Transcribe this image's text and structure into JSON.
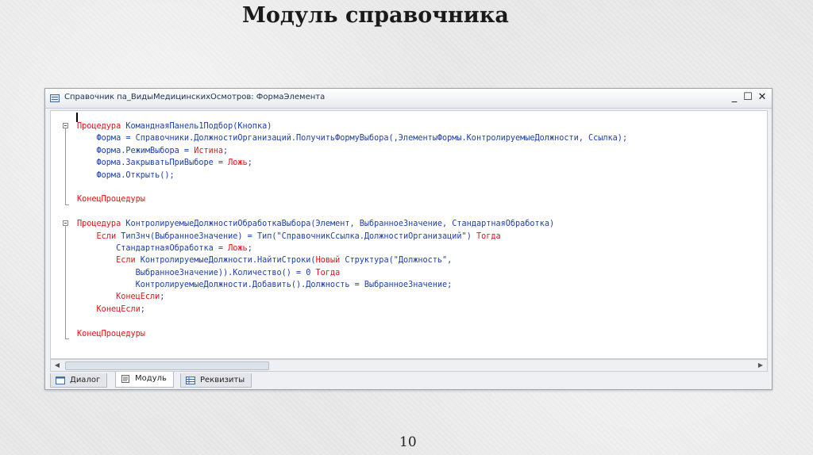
{
  "slide": {
    "title": "Модуль справочника",
    "page_number": "10"
  },
  "window": {
    "title": "Справочник па_ВидыМедицинскихОсмотров: ФормаЭлемента",
    "minimize_symbol": "_",
    "maximize_symbol": "☐",
    "close_symbol": "✕"
  },
  "code_lines": [
    [
      {
        "t": "Процедура ",
        "c": "kw"
      },
      {
        "t": "КоманднаяПанель1Подбор(Кнопка)",
        "c": "id"
      }
    ],
    [
      {
        "t": "    Форма = Справочники.ДолжностиОрганизаций.ПолучитьФормуВыбора(,ЭлементыФормы.КонтролируемыеДолжности, Ссылка);",
        "c": "id"
      }
    ],
    [
      {
        "t": "    Форма.РежимВыбора = ",
        "c": "id"
      },
      {
        "t": "Истина",
        "c": "kw"
      },
      {
        "t": ";",
        "c": "id"
      }
    ],
    [
      {
        "t": "    Форма.ЗакрыватьПриВыборе = ",
        "c": "id"
      },
      {
        "t": "Ложь",
        "c": "kw"
      },
      {
        "t": ";",
        "c": "id"
      }
    ],
    [
      {
        "t": "    Форма.Открыть();",
        "c": "id"
      }
    ],
    [
      {
        "t": "",
        "c": "id"
      }
    ],
    [
      {
        "t": "КонецПроцедуры",
        "c": "kw"
      }
    ],
    [
      {
        "t": "",
        "c": "id"
      }
    ],
    [
      {
        "t": "Процедура ",
        "c": "kw"
      },
      {
        "t": "КонтролируемыеДолжностиОбработкаВыбора(Элемент, ВыбранноеЗначение, СтандартнаяОбработка)",
        "c": "id"
      }
    ],
    [
      {
        "t": "    ",
        "c": "id"
      },
      {
        "t": "Если ",
        "c": "kw"
      },
      {
        "t": "ТипЗнч(ВыбранноеЗначение) = Тип(\"СправочникСсылка.ДолжностиОрганизаций\") ",
        "c": "id"
      },
      {
        "t": "Тогда",
        "c": "kw"
      }
    ],
    [
      {
        "t": "        СтандартнаяОбработка = ",
        "c": "id"
      },
      {
        "t": "Ложь",
        "c": "kw"
      },
      {
        "t": ";",
        "c": "id"
      }
    ],
    [
      {
        "t": "        ",
        "c": "id"
      },
      {
        "t": "Если ",
        "c": "kw"
      },
      {
        "t": "КонтролируемыеДолжности.НайтиСтроки(",
        "c": "id"
      },
      {
        "t": "Новый ",
        "c": "kw"
      },
      {
        "t": "Структура(\"Должность\",",
        "c": "id"
      }
    ],
    [
      {
        "t": "            ВыбранноеЗначение)).Количество() = 0 ",
        "c": "id"
      },
      {
        "t": "Тогда",
        "c": "kw"
      }
    ],
    [
      {
        "t": "            КонтролируемыеДолжности.Добавить().Должность = ВыбранноеЗначение;",
        "c": "id"
      }
    ],
    [
      {
        "t": "        ",
        "c": "id"
      },
      {
        "t": "КонецЕсли",
        "c": "kw"
      },
      {
        "t": ";",
        "c": "id"
      }
    ],
    [
      {
        "t": "    ",
        "c": "id"
      },
      {
        "t": "КонецЕсли",
        "c": "kw"
      },
      {
        "t": ";",
        "c": "id"
      }
    ],
    [
      {
        "t": "",
        "c": "id"
      }
    ],
    [
      {
        "t": "КонецПроцедуры",
        "c": "kw"
      }
    ]
  ],
  "colors": {
    "keyword": "#e0151b",
    "identifier": "#1f3fa8"
  },
  "tabs": [
    {
      "label": "Диалог",
      "icon": "dialog-form-icon",
      "active": false
    },
    {
      "label": "Модуль",
      "icon": "module-document-icon",
      "active": true
    },
    {
      "label": "Реквизиты",
      "icon": "attributes-table-icon",
      "active": false
    }
  ]
}
